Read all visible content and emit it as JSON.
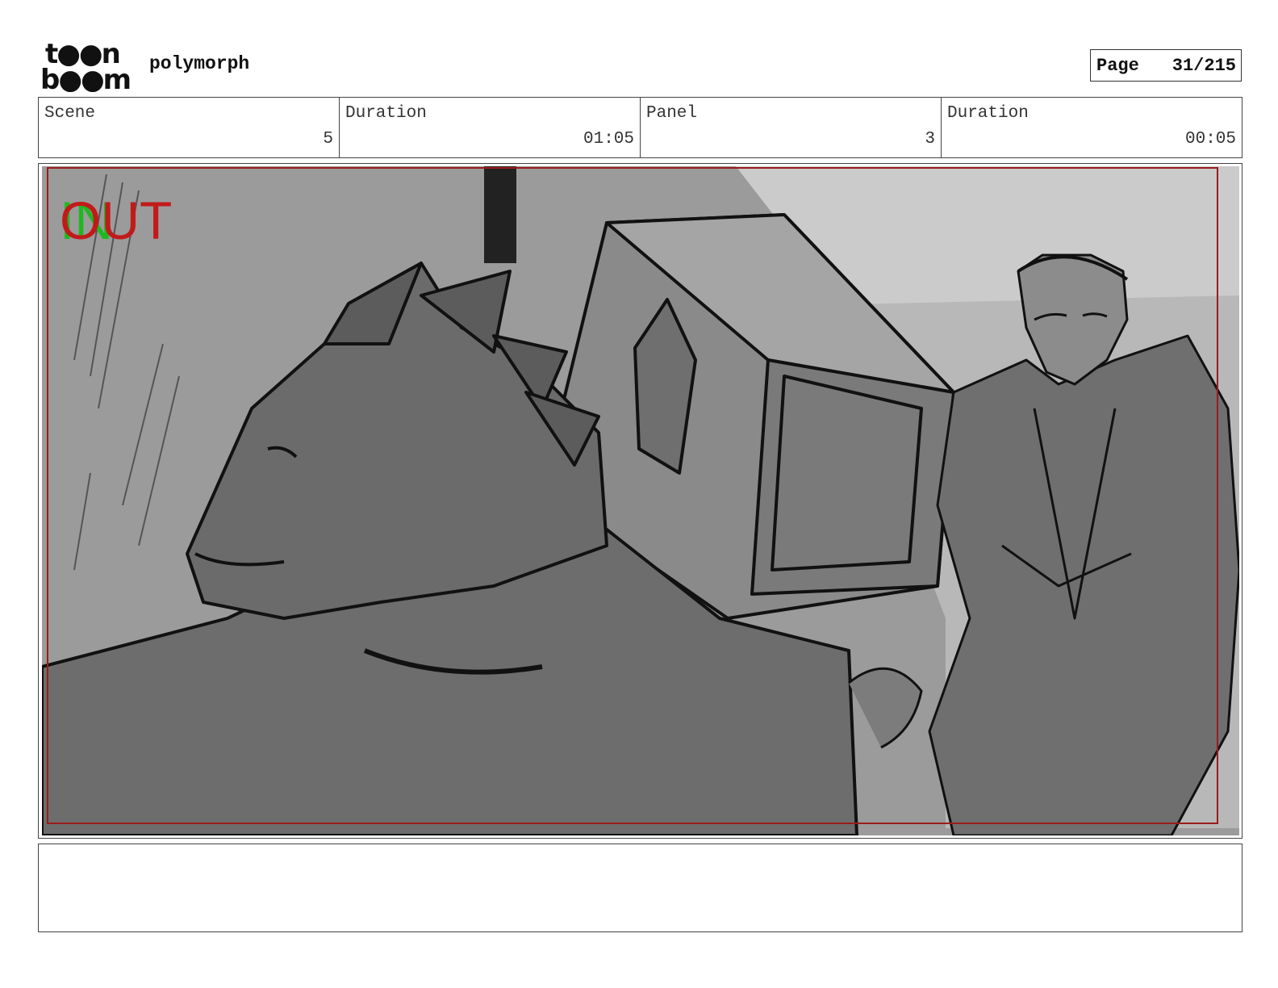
{
  "header": {
    "logo_top": "t●●n",
    "logo_bottom": "b●●m",
    "project_title": "polymorph",
    "page_label": "Page",
    "page_value": "31/215"
  },
  "info": {
    "scene_label": "Scene",
    "scene_value": "5",
    "scene_duration_label": "Duration",
    "scene_duration_value": "01:05",
    "panel_label": "Panel",
    "panel_value": "3",
    "panel_duration_label": "Duration",
    "panel_duration_value": "00:05"
  },
  "panel": {
    "in_marker": "IN",
    "out_marker": "OUT",
    "colors": {
      "in": "#1fb81f",
      "out": "#c21a1a",
      "safe_frame": "#9a1c1c"
    }
  },
  "notes": {
    "text": ""
  }
}
